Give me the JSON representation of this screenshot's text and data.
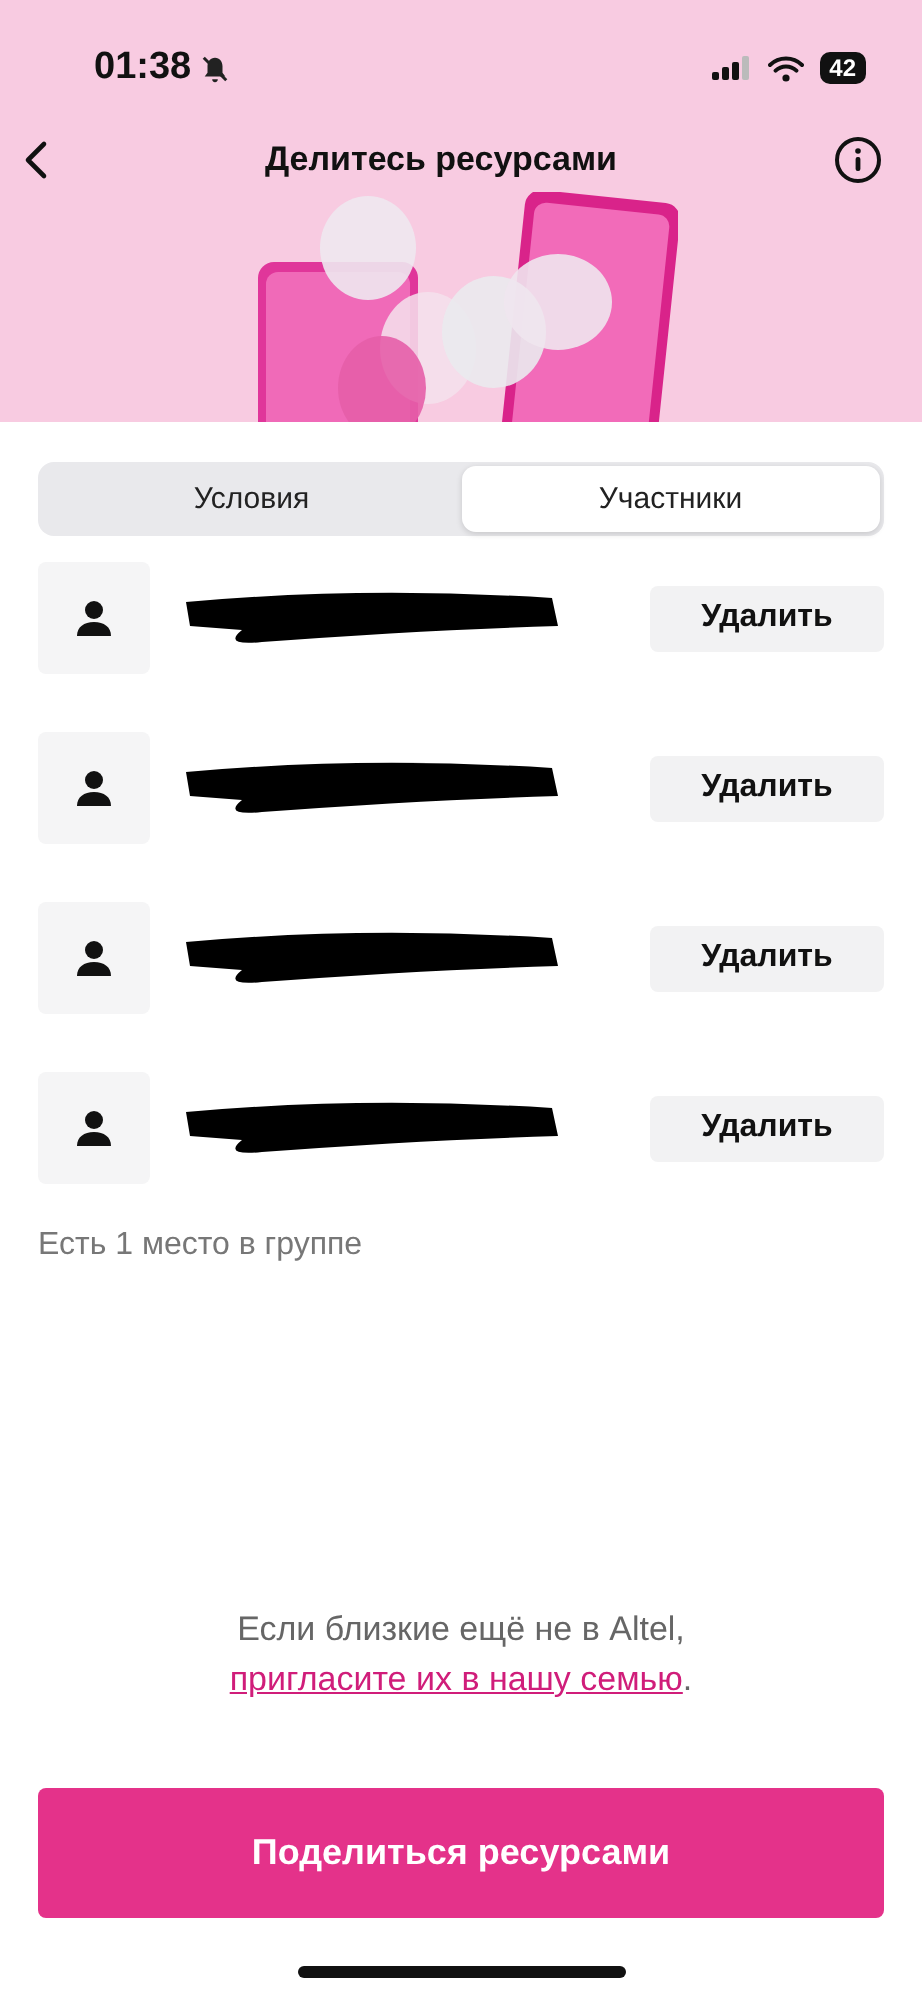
{
  "status_bar": {
    "time": "01:38",
    "battery": "42"
  },
  "header": {
    "title": "Делитесь ресурсами"
  },
  "tabs": [
    {
      "label": "Условия",
      "selected": false
    },
    {
      "label": "Участники",
      "selected": true
    }
  ],
  "members": [
    {
      "name_redacted": true,
      "action": "Удалить"
    },
    {
      "name_redacted": true,
      "action": "Удалить"
    },
    {
      "name_redacted": true,
      "action": "Удалить"
    },
    {
      "name_redacted": true,
      "action": "Удалить"
    }
  ],
  "free_slots_note": "Есть 1 место в группе",
  "invite": {
    "text": "Если близкие ещё не в Altel,",
    "link": "пригласите их в нашу семью",
    "end": "."
  },
  "primary_button": "Поделиться ресурсами"
}
